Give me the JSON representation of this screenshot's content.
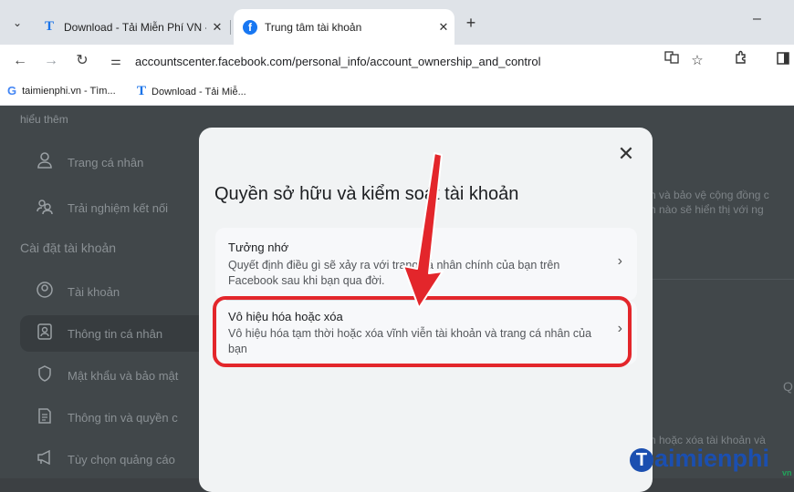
{
  "browser": {
    "tabs": [
      {
        "label": "Download - Tải Miễn Phí VN - P",
        "favicon": "T",
        "active": false
      },
      {
        "label": "Trung tâm tài khoản",
        "favicon": "f",
        "active": true
      }
    ],
    "tab_close": "✕",
    "new_tab": "+",
    "minimize": "–",
    "url": "accountscenter.facebook.com/personal_info/account_ownership_and_control",
    "bookmarks": [
      {
        "label": "taimienphi.vn - Tìm...",
        "icon": "G"
      },
      {
        "label": "Download - Tải Miễ...",
        "icon": "T"
      }
    ]
  },
  "sidebar": {
    "top_text": "hiểu thêm",
    "items_top": [
      {
        "label": "Trang cá nhân",
        "icon": "person-icon"
      },
      {
        "label": "Trải nghiệm kết nối",
        "icon": "people-icon"
      }
    ],
    "section_heading": "Cài đặt tài khoản",
    "items": [
      {
        "label": "Tài khoản",
        "icon": "account-icon"
      },
      {
        "label": "Thông tin cá nhân",
        "icon": "id-card-icon",
        "active": true
      },
      {
        "label": "Mật khẩu và bảo mật",
        "icon": "shield-icon"
      },
      {
        "label": "Thông tin và quyền c",
        "icon": "info-permission-icon"
      },
      {
        "label": "Tùy chọn quảng cáo",
        "icon": "megaphone-icon"
      }
    ]
  },
  "right_panel": {
    "line1": "n và bảo vệ cộng đồng c",
    "line2": "n nào sẽ hiển thị với ng",
    "bottom": "n hoặc xóa tài khoản và",
    "q": "Q"
  },
  "modal": {
    "title": "Quyền sở hữu và kiểm soát tài khoản",
    "close": "✕",
    "options": [
      {
        "title": "Tưởng nhớ",
        "description": "Quyết định điều gì sẽ xảy ra với trang cá nhân chính của bạn trên Facebook sau khi bạn qua đời.",
        "chevron": "›"
      },
      {
        "title": "Vô hiệu hóa hoặc xóa",
        "description": "Vô hiệu hóa tạm thời hoặc xóa vĩnh viễn tài khoản và trang cá nhân của bạn",
        "chevron": "›"
      }
    ]
  },
  "watermark": {
    "letter": "T",
    "text": "aimienphi",
    "sub": "vn"
  },
  "colors": {
    "highlight": "#e3262b",
    "facebook_blue": "#1877f2"
  }
}
